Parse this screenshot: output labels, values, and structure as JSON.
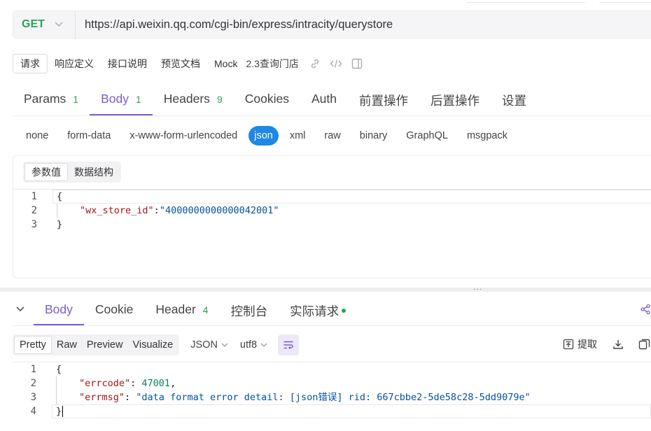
{
  "request": {
    "method": "GET",
    "url": "https://api.weixin.qq.com/cgi-bin/express/intracity/querystore"
  },
  "doc_tabs": {
    "items": [
      "请求",
      "响应定义",
      "接口说明",
      "预览文档",
      "Mock"
    ],
    "active": "请求",
    "title": "2.3查询门店",
    "icons": [
      "link-icon",
      "code-icon",
      "panel-icon"
    ]
  },
  "main_tabs": {
    "items": [
      {
        "label": "Params",
        "count": "1"
      },
      {
        "label": "Body",
        "count": "1"
      },
      {
        "label": "Headers",
        "count": "9"
      },
      {
        "label": "Cookies",
        "count": ""
      },
      {
        "label": "Auth",
        "count": ""
      },
      {
        "label": "前置操作",
        "count": ""
      },
      {
        "label": "后置操作",
        "count": ""
      },
      {
        "label": "设置",
        "count": ""
      }
    ],
    "active": "Body"
  },
  "body_types": {
    "items": [
      "none",
      "form-data",
      "x-www-form-urlencoded",
      "json",
      "xml",
      "raw",
      "binary",
      "GraphQL",
      "msgpack"
    ],
    "active": "json"
  },
  "body_editor": {
    "sub_tabs": [
      "参数值",
      "数据结构"
    ],
    "active": "参数值",
    "line_numbers": [
      "1",
      "2",
      "3"
    ],
    "lines": {
      "l1": "{",
      "l2_key": "\"wx_store_id\"",
      "l2_colon": ":",
      "l2_value": "\"4000000000000042001\"",
      "l3": "}"
    }
  },
  "splitter": {
    "handle": "···"
  },
  "response_tabs": {
    "items": [
      {
        "label": "Body",
        "count": ""
      },
      {
        "label": "Cookie",
        "count": ""
      },
      {
        "label": "Header",
        "count": "4"
      },
      {
        "label": "控制台",
        "count": ""
      },
      {
        "label": "实际请求",
        "count": ""
      }
    ],
    "active": "Body"
  },
  "response_toolbar": {
    "views": [
      "Pretty",
      "Raw",
      "Preview",
      "Visualize"
    ],
    "active": "Pretty",
    "format": "JSON",
    "encoding": "utf8",
    "extract_label": "提取"
  },
  "response_body": {
    "line_numbers": [
      "1",
      "2",
      "3",
      "4"
    ],
    "lines": {
      "l1": "{",
      "l2_key": "\"errcode\"",
      "l2_colon": ": ",
      "l2_value": "47001",
      "l2_comma": ",",
      "l3_key": "\"errmsg\"",
      "l3_colon": ": ",
      "l3_value": "\"data format error detail: [json错误] rid: 667cbbe2-5de58c28-5dd9079e\"",
      "l4": "}"
    }
  },
  "colors": {
    "accent": "#7b5bd6",
    "method_get": "#27a35a",
    "json_active": "#1e88e5"
  }
}
